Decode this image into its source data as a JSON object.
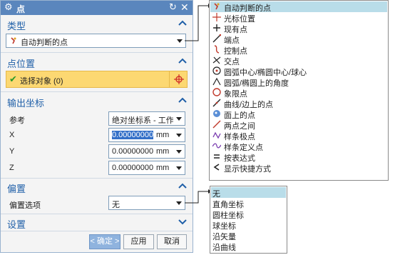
{
  "dialog": {
    "title": "点",
    "icons": {
      "settings": "gear-icon",
      "reset": "reset-icon",
      "close": "close-icon"
    }
  },
  "type_section": {
    "label": "类型",
    "value": "自动判断的点"
  },
  "point_location": {
    "label": "点位置",
    "select_label": "选择对象 (0)"
  },
  "output_coords": {
    "label": "输出坐标",
    "reference_label": "参考",
    "reference_value": "绝对坐标系 - 工作",
    "fields": [
      {
        "label": "X",
        "value": "0.00000000",
        "unit": "mm",
        "selected": true
      },
      {
        "label": "Y",
        "value": "0.00000000",
        "unit": "mm",
        "selected": false
      },
      {
        "label": "Z",
        "value": "0.00000000",
        "unit": "mm",
        "selected": false
      }
    ]
  },
  "offset": {
    "label": "偏置",
    "option_label": "偏置选项",
    "option_value": "无"
  },
  "settings": {
    "label": "设置"
  },
  "buttons": {
    "ok": "< 确定 >",
    "apply": "应用",
    "cancel": "取消"
  },
  "type_menu": {
    "items": [
      {
        "label": "自动判断的点",
        "icon": "inferred-point-icon",
        "highlighted": true
      },
      {
        "label": "光标位置",
        "icon": "cursor-location-icon"
      },
      {
        "label": "现有点",
        "icon": "existing-point-icon"
      },
      {
        "label": "端点",
        "icon": "end-point-icon"
      },
      {
        "label": "控制点",
        "icon": "control-point-icon"
      },
      {
        "label": "交点",
        "icon": "intersection-icon"
      },
      {
        "label": "圆弧中心/椭圆中心/球心",
        "icon": "arc-center-icon"
      },
      {
        "label": "圆弧/椭圆上的角度",
        "icon": "arc-angle-icon"
      },
      {
        "label": "象限点",
        "icon": "quadrant-point-icon"
      },
      {
        "label": "曲线/边上的点",
        "icon": "point-on-curve-icon"
      },
      {
        "label": "面上的点",
        "icon": "point-on-face-icon"
      },
      {
        "label": "两点之间",
        "icon": "between-points-icon"
      },
      {
        "label": "样条极点",
        "icon": "spline-pole-icon"
      },
      {
        "label": "样条定义点",
        "icon": "spline-defining-point-icon"
      },
      {
        "label": "按表达式",
        "icon": "expression-icon"
      },
      {
        "label": "显示快捷方式",
        "icon": "shortcut-icon"
      }
    ]
  },
  "offset_menu": {
    "items": [
      {
        "label": "无",
        "highlighted": true
      },
      {
        "label": "直角坐标"
      },
      {
        "label": "圆柱坐标"
      },
      {
        "label": "球坐标"
      },
      {
        "label": "沿矢量"
      },
      {
        "label": "沿曲线"
      }
    ]
  },
  "colors": {
    "title_bar": "#5a86bd",
    "section_label": "#1f5fa8",
    "selection_row": "#fcd872",
    "menu_highlight": "#b9dde9"
  }
}
